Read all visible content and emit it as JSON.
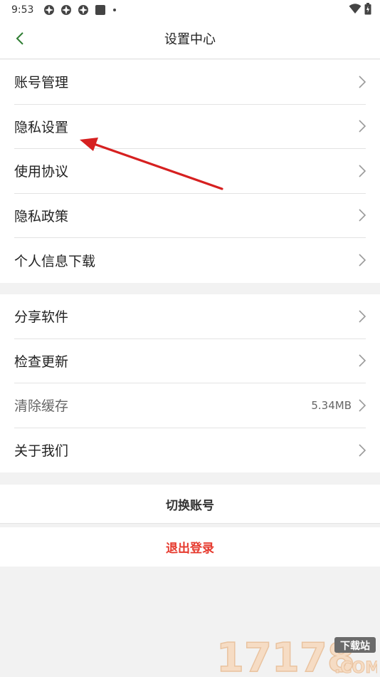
{
  "status_bar": {
    "time": "9:53",
    "notification_icons": [
      "app-icon",
      "app-icon",
      "app-icon",
      "square-icon",
      "dot-icon"
    ],
    "right_icons": [
      "wifi-icon",
      "battery-icon"
    ]
  },
  "header": {
    "back_icon": "chevron-left-icon",
    "title": "设置中心"
  },
  "section1": {
    "items": [
      {
        "label": "账号管理"
      },
      {
        "label": "隐私设置"
      },
      {
        "label": "使用协议"
      },
      {
        "label": "隐私政策"
      },
      {
        "label": "个人信息下载"
      }
    ]
  },
  "section2": {
    "items": [
      {
        "label": "分享软件"
      },
      {
        "label": "检查更新"
      },
      {
        "label": "清除缓存",
        "value": "5.34MB"
      },
      {
        "label": "关于我们"
      }
    ]
  },
  "actions": {
    "switch_account": "切换账号",
    "logout": "退出登录"
  },
  "colors": {
    "accent_green": "#2e7d32",
    "logout_red": "#e63a2e",
    "annotation_arrow": "#d62020",
    "background": "#f2f2f2"
  },
  "watermark": {
    "number": "17178",
    "badge": "下载站",
    "domain": ".COM"
  }
}
